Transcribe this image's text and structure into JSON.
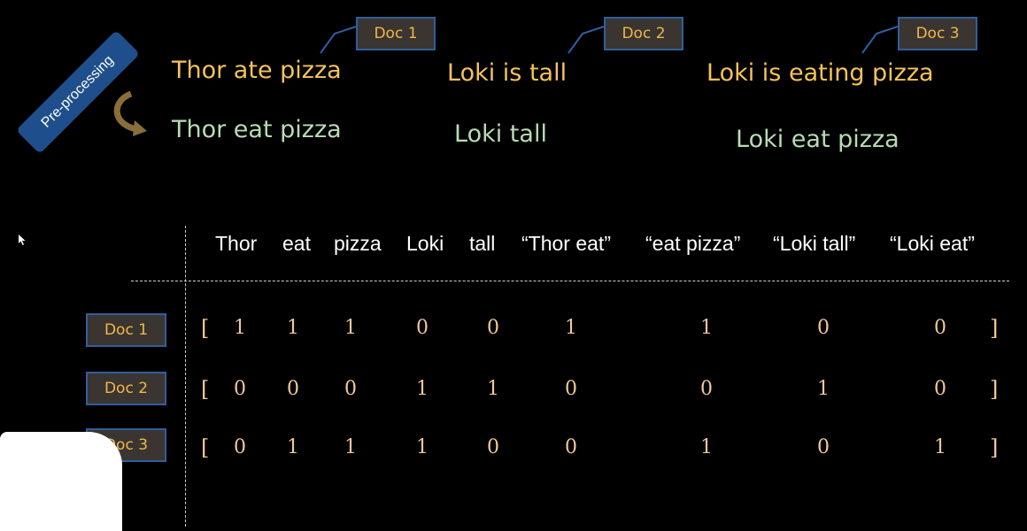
{
  "preprocess_label": "Pre-processing",
  "docs": [
    {
      "tag": "Doc 1",
      "original": "Thor ate pizza",
      "processed": "Thor eat pizza"
    },
    {
      "tag": "Doc 2",
      "original": "Loki is tall",
      "processed": "Loki tall"
    },
    {
      "tag": "Doc 3",
      "original": "Loki is eating pizza",
      "processed": "Loki eat pizza"
    }
  ],
  "columns": [
    "Thor",
    "eat",
    "pizza",
    "Loki",
    "tall",
    "“Thor eat”",
    "“eat pizza”",
    "“Loki tall”",
    "“Loki eat”"
  ],
  "matrix": [
    {
      "label": "Doc 1",
      "values": [
        "1",
        "1",
        "1",
        "0",
        "0",
        "1",
        "1",
        "0",
        "0"
      ]
    },
    {
      "label": "Doc 2",
      "values": [
        "0",
        "0",
        "0",
        "1",
        "1",
        "0",
        "0",
        "1",
        "0"
      ]
    },
    {
      "label": "Doc 3",
      "values": [
        "0",
        "1",
        "1",
        "1",
        "0",
        "0",
        "1",
        "0",
        "1"
      ]
    }
  ],
  "bracket_open": "[",
  "bracket_close": "]",
  "colors": {
    "original_text": "#f5c35a",
    "processed_text": "#b8dcb4",
    "tag_border": "#2f5f9e",
    "matrix_values": "#f1c79a"
  },
  "icons": [
    "curved-arrow-icon",
    "mouse-cursor-icon"
  ]
}
